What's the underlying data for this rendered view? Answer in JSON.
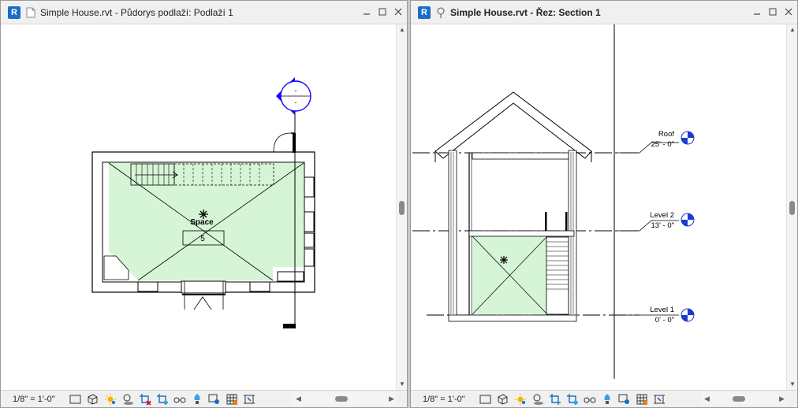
{
  "left_window": {
    "app_badge": "R",
    "title": "Simple House.rvt - Půdorys podlaží: Podlaží 1",
    "view_scale": "1/8\" = 1'-0\"",
    "plan": {
      "space_label": "Space",
      "space_number": "5",
      "section_marker_top": "-",
      "section_marker_bottom": "-"
    }
  },
  "right_window": {
    "app_badge": "R",
    "title": "Simple House.rvt - Řez: Section 1",
    "view_scale": "1/8\" = 1'-0\"",
    "levels": [
      {
        "name": "Roof",
        "elevation": "25' - 0\""
      },
      {
        "name": "Level 2",
        "elevation": "13' - 0\""
      },
      {
        "name": "Level 1",
        "elevation": "0' - 0\""
      }
    ]
  },
  "icons": {
    "window_controls": [
      "minimize-icon",
      "maximize-icon",
      "close-icon"
    ],
    "view_tools": [
      "detail-level-icon",
      "visual-style-icon",
      "sun-path-icon",
      "shadows-icon",
      "crop-view-icon",
      "show-crop-region-icon",
      "temporary-hide-icon",
      "reveal-hidden-icon",
      "worksharing-icon",
      "analytical-model-icon",
      "highlight-displacement-icon"
    ]
  },
  "colors": {
    "space_fill": "#d6f5d6",
    "revit_blue": "#1a6cc9",
    "section_head": "#1400ff"
  }
}
